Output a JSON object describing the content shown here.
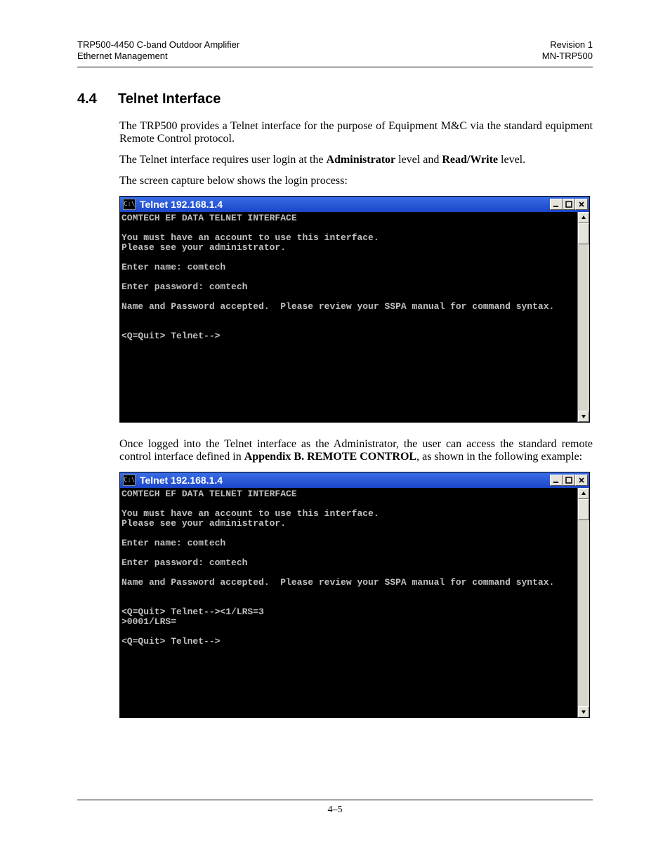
{
  "header": {
    "left1": "TRP500-4450 C-band Outdoor Amplifier",
    "left2": "Ethernet Management",
    "right1": "Revision 1",
    "right2": "MN-TRP500"
  },
  "section": {
    "number": "4.4",
    "title": "Telnet Interface"
  },
  "para1a": "The TRP500 provides a Telnet interface for the purpose of Equipment M&C via the standard equipment Remote Control protocol.",
  "para2_pre": "The Telnet interface requires user login at the ",
  "para2_b1": "Administrator",
  "para2_mid": " level and ",
  "para2_b2": "Read/Write",
  "para2_post": " level.",
  "para3": "The screen capture below shows the login process:",
  "telnet": {
    "sysmenu_label": "C:\\",
    "title": "Telnet 192.168.1.4",
    "lines1": [
      "COMTECH EF DATA TELNET INTERFACE",
      "",
      "You must have an account to use this interface.",
      "Please see your administrator.",
      "",
      "Enter name: comtech",
      "",
      "Enter password: comtech",
      "",
      "Name and Password accepted.  Please review your SSPA manual for command syntax.",
      "",
      "",
      "<Q=Quit> Telnet-->"
    ],
    "lines2": [
      "COMTECH EF DATA TELNET INTERFACE",
      "",
      "You must have an account to use this interface.",
      "Please see your administrator.",
      "",
      "Enter name: comtech",
      "",
      "Enter password: comtech",
      "",
      "Name and Password accepted.  Please review your SSPA manual for command syntax.",
      "",
      "",
      "<Q=Quit> Telnet--><1/LRS=3",
      ">0001/LRS=",
      "",
      "<Q=Quit> Telnet-->"
    ]
  },
  "para4_pre": "Once logged into the Telnet interface as the Administrator, the user can access the standard remote control interface defined in ",
  "para4_b": "Appendix B. REMOTE CONTROL",
  "para4_post": ", as shown in the following example:",
  "footer": {
    "pagenum": "4–5"
  }
}
